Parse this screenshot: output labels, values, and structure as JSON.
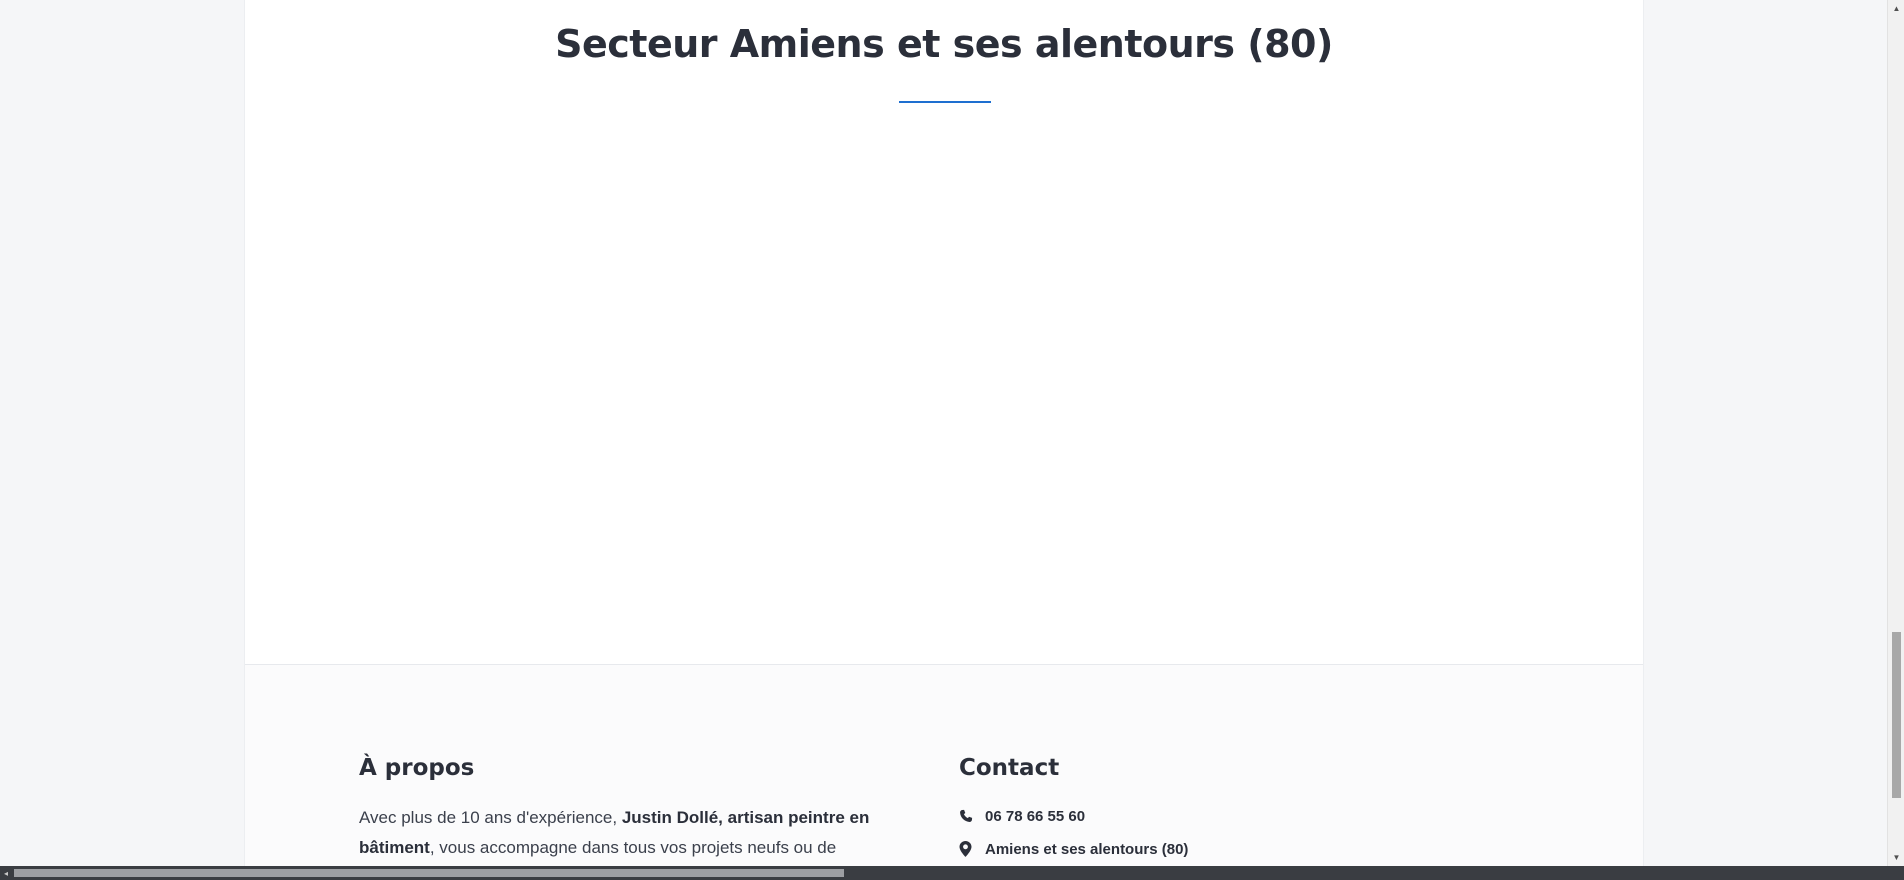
{
  "section": {
    "title": "Secteur Amiens et ses alentours (80)",
    "accent_color": "#1e6fd0"
  },
  "footer": {
    "about": {
      "heading": "À propos",
      "text_intro": "Avec plus de 10 ans d'expérience, ",
      "text_bold": "Justin Dollé, artisan peintre en bâtiment",
      "text_rest": ", vous accompagne dans tous vos projets neufs ou de"
    },
    "contact": {
      "heading": "Contact",
      "phone": "06 78 66 55 60",
      "phone_icon": "phone-icon",
      "location": "Amiens et ses alentours (80)",
      "location_icon": "map-marker-icon"
    }
  },
  "scrollbars": {
    "vertical_position": 0.88,
    "horizontal_position": 0.0
  }
}
